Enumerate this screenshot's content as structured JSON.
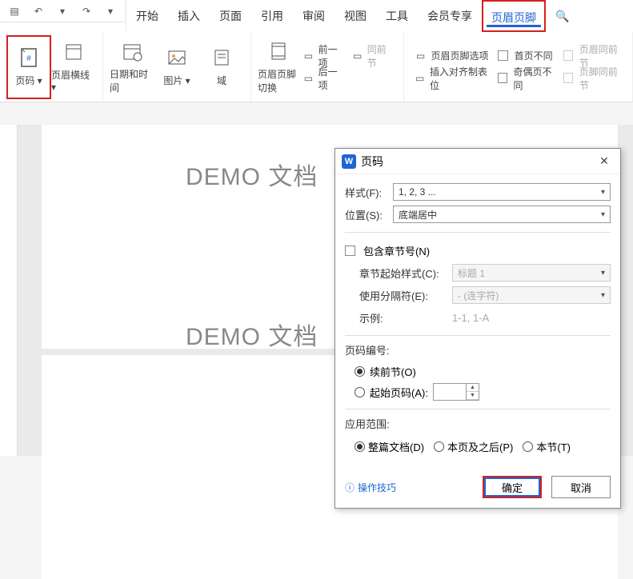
{
  "qat": {
    "undo": "↶",
    "redo": "↷"
  },
  "tabs": [
    "开始",
    "插入",
    "页面",
    "引用",
    "审阅",
    "视图",
    "工具",
    "会员专享",
    "页眉页脚"
  ],
  "active_tab": "页眉页脚",
  "search_icon": "🔍",
  "ribbon": {
    "page_number": "页码",
    "header_line": "页眉横线",
    "date_time": "日期和时间",
    "picture": "图片",
    "field": "域",
    "switch": "页眉页脚切换",
    "prev": "前一项",
    "next": "后一项",
    "same_prev": "同前节",
    "options": "页眉页脚选项",
    "insert_tab": "插入对齐制表位",
    "first_diff": "首页不同",
    "odd_even_diff": "奇偶页不同",
    "header_same": "页眉同前节",
    "footer_same": "页脚同前节"
  },
  "doc": {
    "text": "DEMO 文档"
  },
  "dialog": {
    "title": "页码",
    "format_label": "样式(F):",
    "format_value": "1, 2, 3 ...",
    "position_label": "位置(S):",
    "position_value": "底端居中",
    "include_chapter": "包含章节号(N)",
    "chapter_style_label": "章节起始样式(C):",
    "chapter_style_value": "标题 1",
    "separator_label": "使用分隔符(E):",
    "separator_value": "-  (连字符)",
    "example_label": "示例:",
    "example_value": "1-1, 1-A",
    "numbering_label": "页码编号:",
    "continue": "续前节(O)",
    "start_at": "起始页码(A):",
    "scope_label": "应用范围:",
    "scope_whole": "整篇文档(D)",
    "scope_current": "本页及之后(P)",
    "scope_section": "本节(T)",
    "tips": "操作技巧",
    "ok": "确定",
    "cancel": "取消"
  }
}
